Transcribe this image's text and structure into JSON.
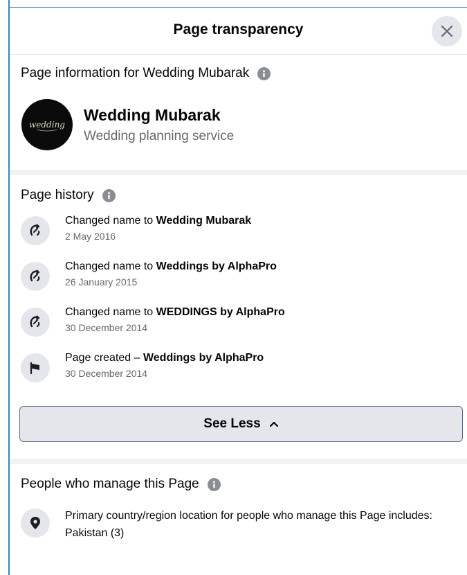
{
  "dialog": {
    "title": "Page transparency",
    "close_icon": "close-icon"
  },
  "page_info": {
    "heading": "Page information for Wedding Mubarak",
    "page_name": "Wedding Mubarak",
    "category": "Wedding planning service",
    "avatar_text": "wedding"
  },
  "history": {
    "heading": "Page history",
    "items": [
      {
        "prefix": "Changed name to ",
        "bold": "Wedding Mubarak",
        "date": "2 May 2016",
        "icon": "name-change-icon"
      },
      {
        "prefix": "Changed name to ",
        "bold": "Weddings by AlphaPro",
        "date": "26 January 2015",
        "icon": "name-change-icon"
      },
      {
        "prefix": "Changed name to ",
        "bold": "WEDDINGS by AlphaPro",
        "date": "30 December 2014",
        "icon": "name-change-icon"
      },
      {
        "prefix": "Page created – ",
        "bold": "Weddings by AlphaPro",
        "date": "30 December 2014",
        "icon": "flag-icon"
      }
    ],
    "see_less_label": "See Less"
  },
  "managers": {
    "heading": "People who manage this Page",
    "location_text": "Primary country/region location for people who manage this Page includes:",
    "country": "Pakistan (3)"
  }
}
